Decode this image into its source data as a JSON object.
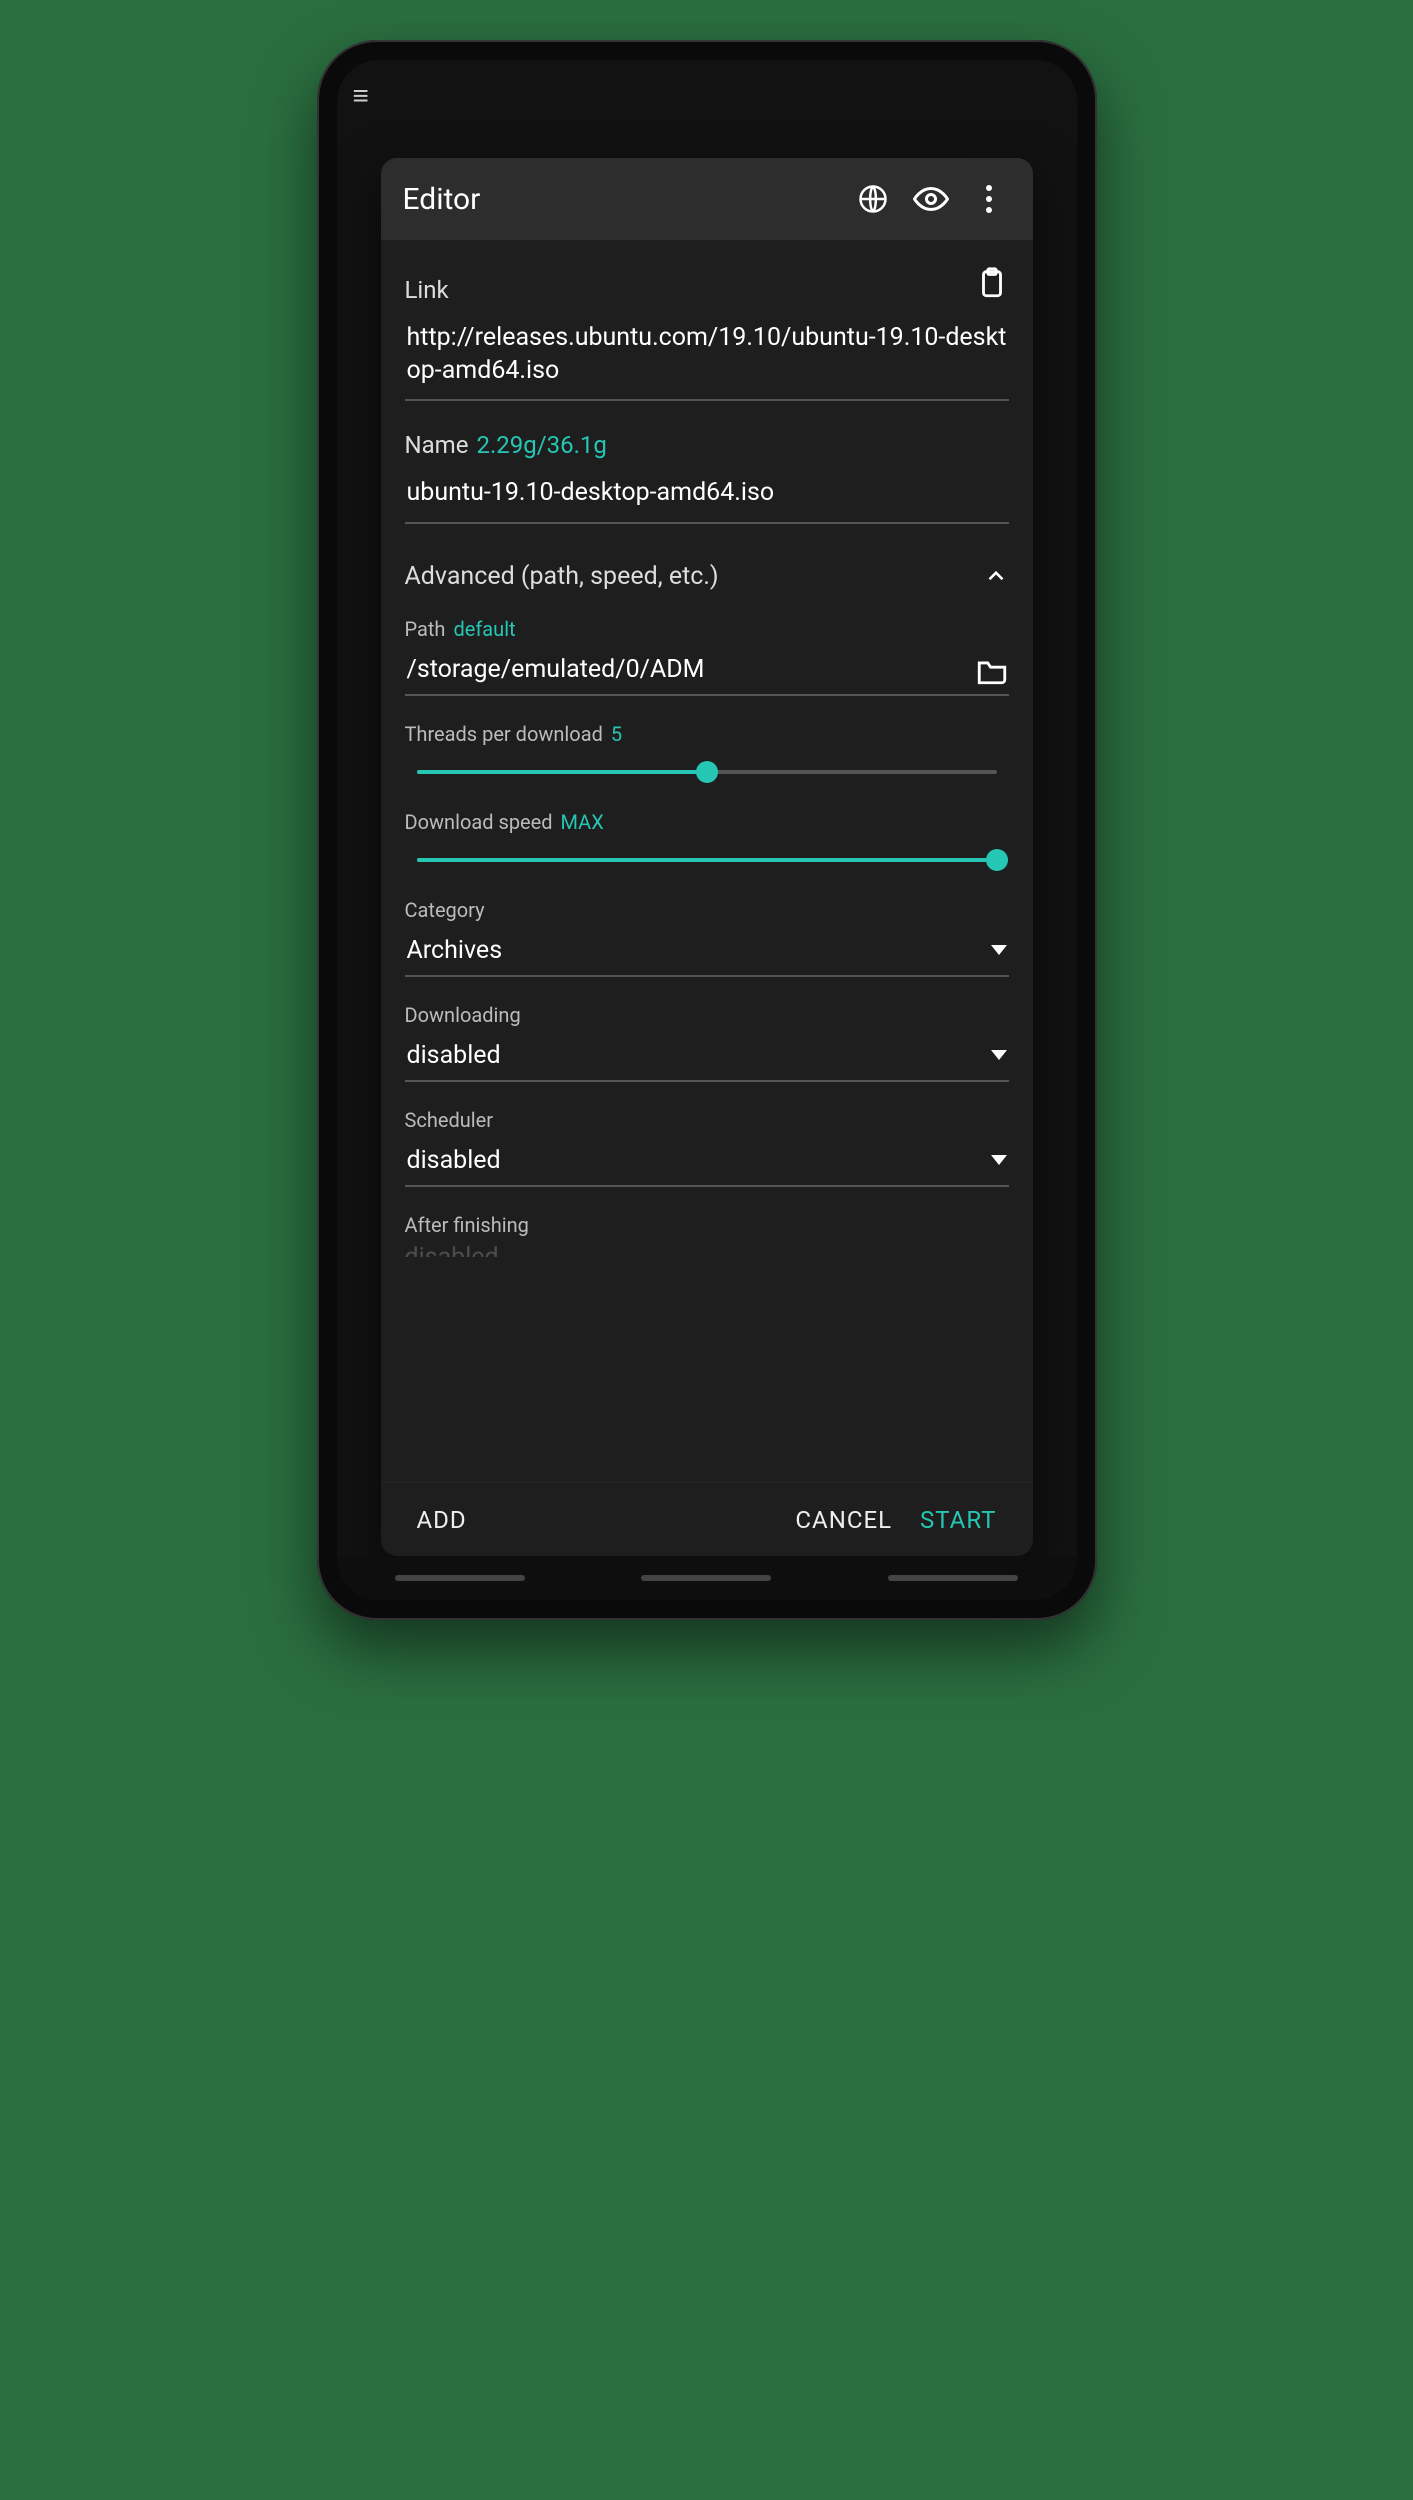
{
  "header": {
    "title": "Editor"
  },
  "link": {
    "label": "Link",
    "value": "http://releases.ubuntu.com/19.10/ubuntu-19.10-desktop-amd64.iso"
  },
  "name": {
    "label": "Name",
    "storage_hint": "2.29g/36.1g",
    "value": "ubuntu-19.10-desktop-amd64.iso"
  },
  "advanced": {
    "label": "Advanced (path, speed, etc.)",
    "expanded": true
  },
  "path": {
    "label": "Path",
    "hint": "default",
    "value": "/storage/emulated/0/ADM"
  },
  "threads": {
    "label": "Threads per download",
    "value": "5",
    "percent": 50
  },
  "speed": {
    "label": "Download speed",
    "value": "MAX",
    "percent": 100
  },
  "category": {
    "label": "Category",
    "value": "Archives"
  },
  "downloading": {
    "label": "Downloading",
    "value": "disabled"
  },
  "scheduler": {
    "label": "Scheduler",
    "value": "disabled"
  },
  "after_finishing": {
    "label": "After finishing",
    "value": "disabled"
  },
  "footer": {
    "add": "ADD",
    "cancel": "CANCEL",
    "start": "START"
  },
  "colors": {
    "accent": "#26c6b4"
  }
}
